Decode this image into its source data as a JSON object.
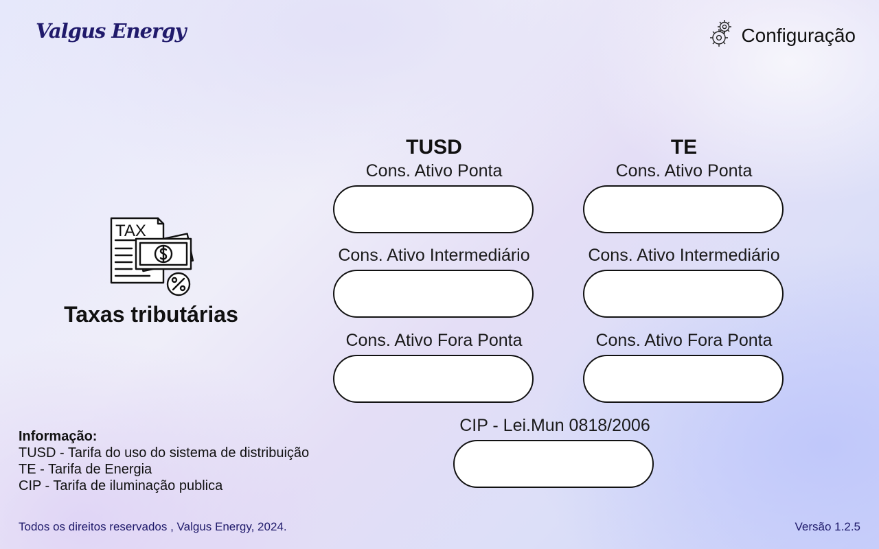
{
  "header": {
    "logo": "Valgus Energy",
    "config_label": "Configuração"
  },
  "sidebar": {
    "icon_text": "TAX",
    "title": "Taxas tributárias"
  },
  "tusd": {
    "heading": "TUSD",
    "ponta_label": "Cons. Ativo Ponta",
    "intermediario_label": "Cons. Ativo Intermediário",
    "fora_ponta_label": "Cons. Ativo Fora Ponta"
  },
  "te": {
    "heading": "TE",
    "ponta_label": "Cons. Ativo Ponta",
    "intermediario_label": "Cons. Ativo Intermediário",
    "fora_ponta_label": "Cons. Ativo Fora Ponta"
  },
  "cip": {
    "label": "CIP - Lei.Mun 0818/2006"
  },
  "info": {
    "title": "Informação:",
    "lines": [
      "TUSD - Tarifa do uso do sistema de distribuição",
      "TE - Tarifa de Energia",
      "CIP - Tarifa de iluminação publica"
    ]
  },
  "footer": {
    "copyright": "Todos os direitos reservados , Valgus Energy, 2024.",
    "version": "Versão 1.2.5"
  }
}
